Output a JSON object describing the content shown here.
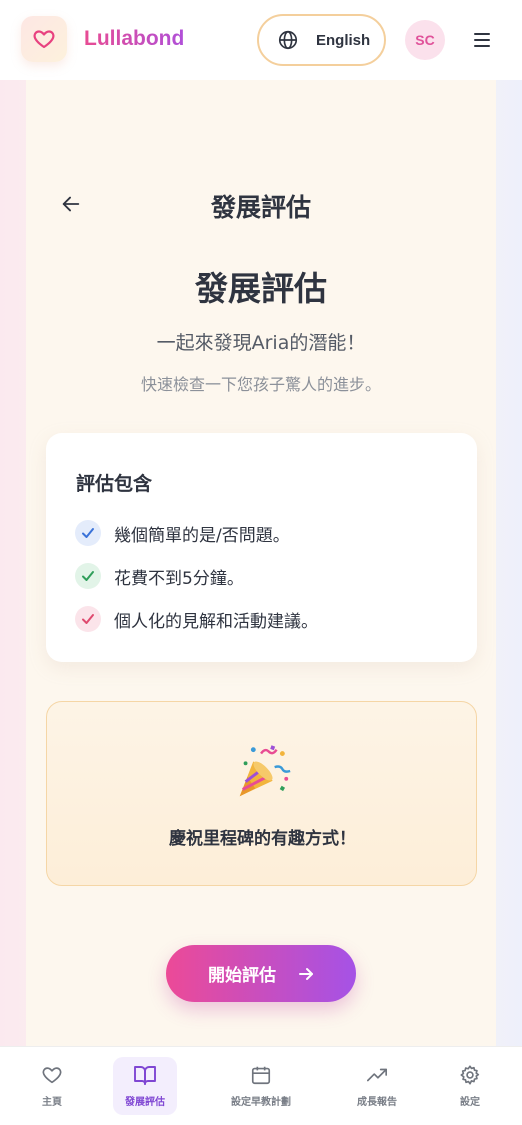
{
  "header": {
    "brand": "Lullabond",
    "language_label": "English",
    "avatar_initials": "SC",
    "logo_icon": "heart-icon",
    "language_icon": "globe-icon",
    "menu_icon": "hamburger-menu-icon"
  },
  "page": {
    "title": "發展評估",
    "hero_title": "發展評估",
    "subtitle": "一起來發現Aria的潛能！",
    "subtext": "快速檢查一下您孩子驚人的進步。"
  },
  "info_card": {
    "heading": "評估包含",
    "items": [
      {
        "text": "幾個簡單的是/否問題。",
        "color": "#3a72d8",
        "bg": "#e4ecfb"
      },
      {
        "text": "花費不到5分鐘。",
        "color": "#2f9e5a",
        "bg": "#e2f4e8"
      },
      {
        "text": "個人化的見解和活動建議。",
        "color": "#df4a6f",
        "bg": "#fbe4ea"
      }
    ]
  },
  "celebrate_card": {
    "icon": "party-popper-icon",
    "text": "慶祝里程碑的有趣方式！"
  },
  "start_button": {
    "label": "開始評估"
  },
  "bottom_nav": {
    "items": [
      {
        "label": "主頁",
        "icon": "heart-icon"
      },
      {
        "label": "發展評估",
        "icon": "book-open-icon",
        "active": true
      },
      {
        "label": "設定早教計劃",
        "icon": "calendar-icon"
      },
      {
        "label": "成長報告",
        "icon": "trending-up-icon"
      },
      {
        "label": "設定",
        "icon": "gear-icon"
      }
    ]
  },
  "colors": {
    "brand_pink": "#e84c93",
    "brand_purple": "#a552e6",
    "active_nav": "#7f46d3"
  }
}
